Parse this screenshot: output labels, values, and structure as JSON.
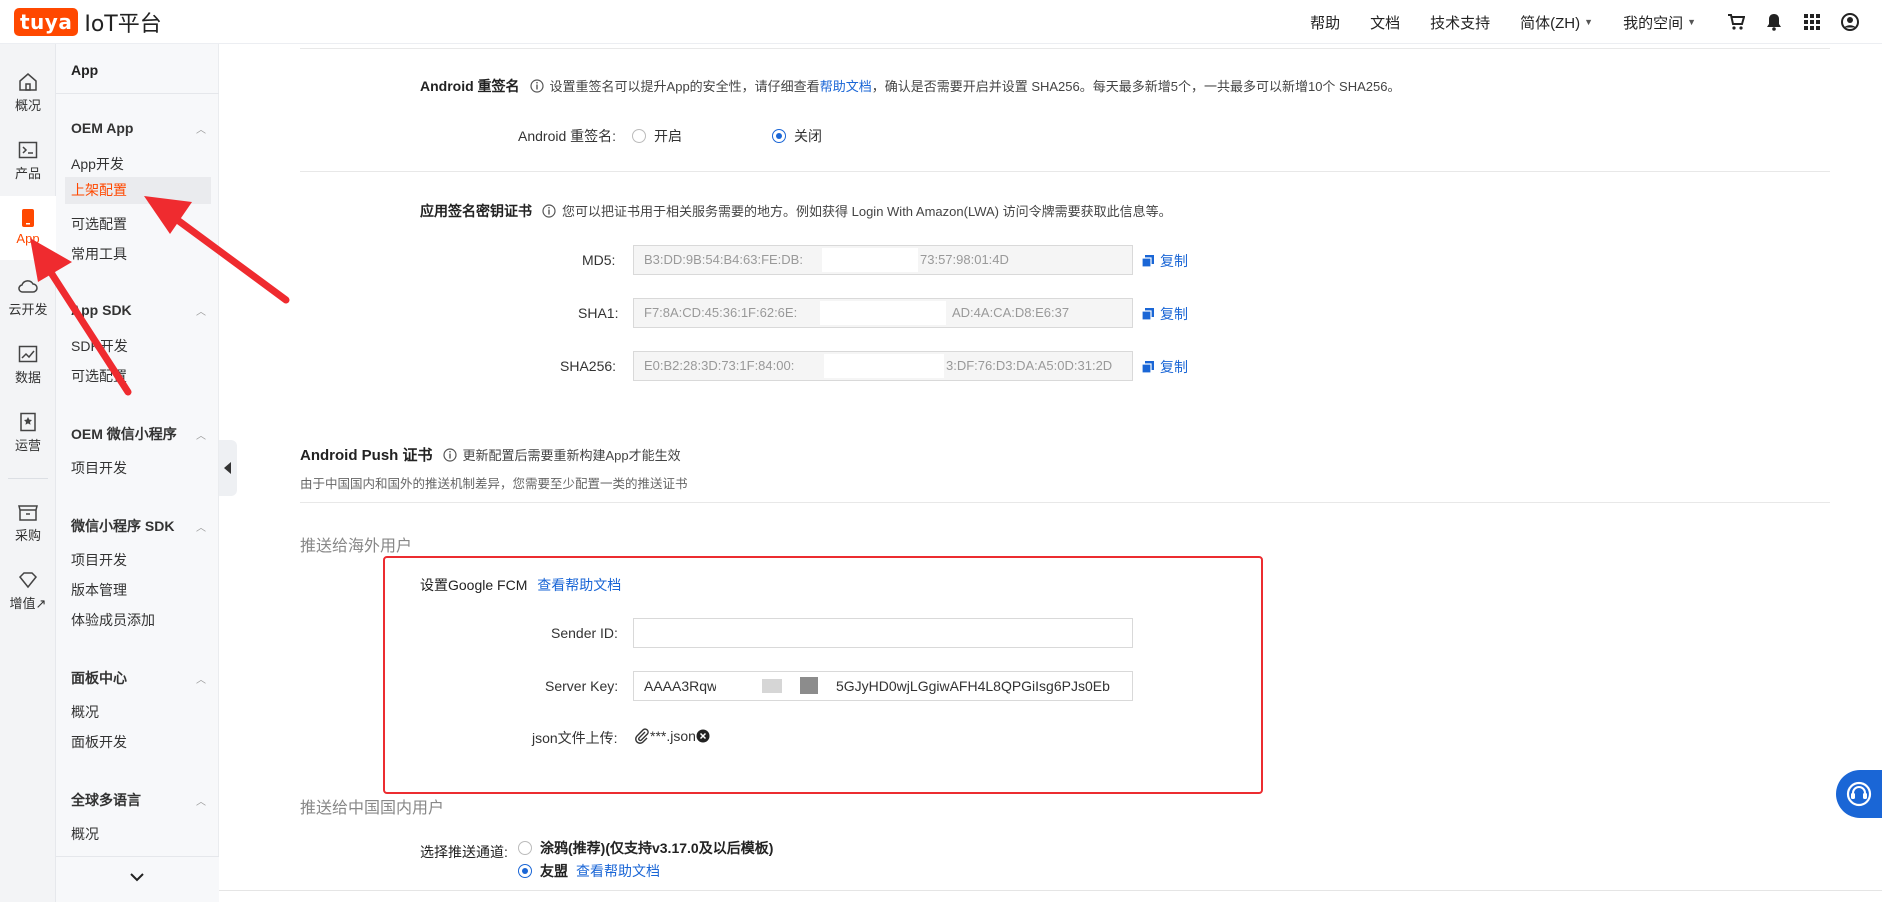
{
  "brand": {
    "badge": "tuya",
    "name": "IoT平台"
  },
  "topnav": {
    "help": "帮助",
    "docs": "文档",
    "support": "技术支持",
    "lang": "简体(ZH)",
    "space": "我的空间"
  },
  "rail": {
    "items": [
      {
        "label": "概况"
      },
      {
        "label": "产品"
      },
      {
        "label": "App"
      },
      {
        "label": "云开发"
      },
      {
        "label": "数据"
      },
      {
        "label": "运营"
      },
      {
        "label": "采购"
      },
      {
        "label": "增值↗"
      }
    ]
  },
  "sidebar": {
    "title": "App",
    "sections": [
      {
        "title": "OEM App",
        "items": [
          "App开发",
          "上架配置",
          "可选配置",
          "常用工具"
        ]
      },
      {
        "title": "App SDK",
        "items": [
          "SDK开发",
          "可选配置"
        ]
      },
      {
        "title": "OEM 微信小程序",
        "items": [
          "项目开发"
        ]
      },
      {
        "title": "微信小程序 SDK",
        "items": [
          "项目开发",
          "版本管理",
          "体验成员添加"
        ]
      },
      {
        "title": "面板中心",
        "items": [
          "概况",
          "面板开发"
        ]
      },
      {
        "title": "全球多语言",
        "items": [
          "概况"
        ]
      }
    ]
  },
  "resign": {
    "title": "Android 重签名",
    "note_before": "设置重签名可以提升App的安全性，请仔细查看",
    "note_link": "帮助文档",
    "note_after": "，确认是否需要开启并设置 SHA256。每天最多新增5个，一共最多可以新增10个 SHA256。",
    "field_label": "Android 重签名:",
    "opt_on": "开启",
    "opt_off": "关闭"
  },
  "cert": {
    "title": "应用签名密钥证书",
    "note": "您可以把证书用于相关服务需要的地方。例如获得 Login With Amazon(LWA) 访问令牌需要获取此信息等。",
    "rows": [
      {
        "label": "MD5:",
        "value_start": "B3:DD:9B:54:B4:63:FE:DB:",
        "value_end": "73:57:98:01:4D"
      },
      {
        "label": "SHA1:",
        "value_start": "F7:8A:CD:45:36:1F:62:6E:",
        "value_end": "AD:4A:CA:D8:E6:37"
      },
      {
        "label": "SHA256:",
        "value_start": "E0:B2:28:3D:73:1F:84:00:",
        "value_end": "3:DF:76:D3:DA:A5:0D:31:2D"
      }
    ],
    "copy_label": "复制"
  },
  "push": {
    "title": "Android Push 证书",
    "note": "更新配置后需要重新构建App才能生效",
    "desc": "由于中国国内和国外的推送机制差异，您需要至少配置一类的推送证书",
    "overseas_title": "推送给海外用户",
    "fcm_title": "设置Google FCM",
    "fcm_link": "查看帮助文档",
    "sender_label": "Sender ID:",
    "sender_value": "",
    "server_label": "Server Key:",
    "server_start": "AAAA3Rqw",
    "server_end": "5GJyHD0wjLGgiwAFH4L8QPGiIsg6PJs0Eb",
    "json_label": "json文件上传:",
    "json_file": "***.json",
    "china_title": "推送给中国国内用户",
    "channel_label": "选择推送通道:",
    "channel_opt1": "涂鸦(推荐)(仅支持v3.17.0及以后模板)",
    "channel_opt2": "友盟",
    "channel_link": "查看帮助文档"
  },
  "colors": {
    "brand": "#ff4800",
    "link": "#1a66d6",
    "highlight": "#ec2c30"
  }
}
